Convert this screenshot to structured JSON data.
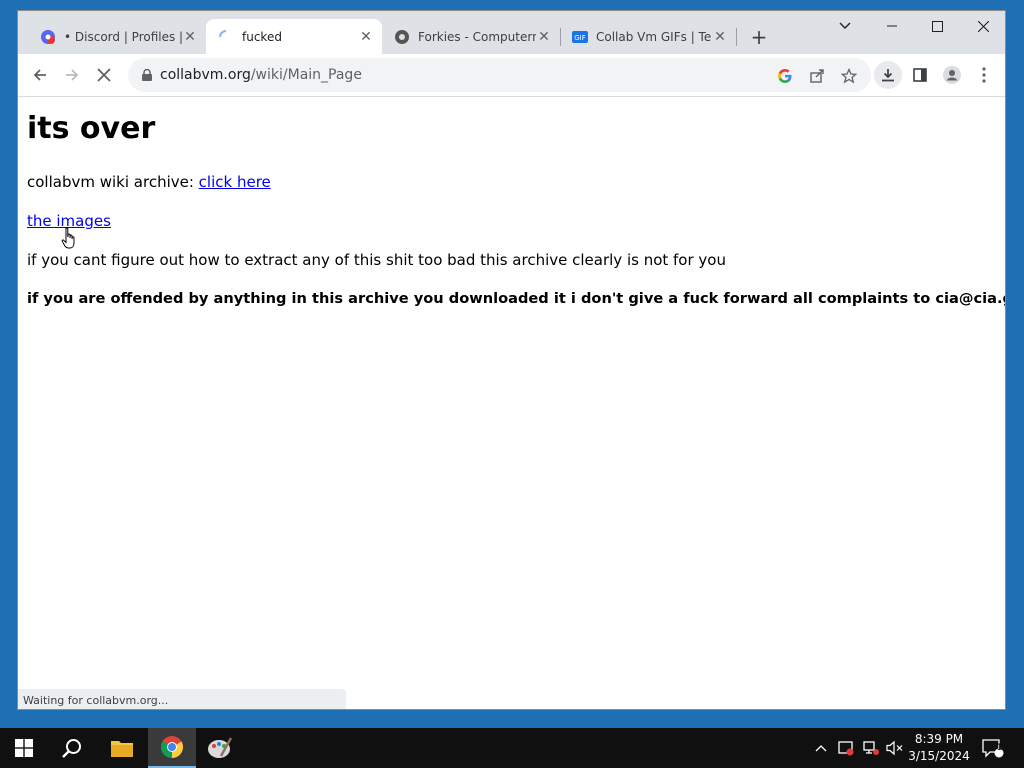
{
  "browser": {
    "tabs": [
      {
        "title": "• Discord | Profiles | U",
        "icon": "discord-favicon"
      },
      {
        "title": "fucked",
        "icon": "loading-spinner-icon"
      },
      {
        "title": "Forkies - Computerne",
        "icon": "forkies-favicon"
      },
      {
        "title": "Collab Vm GIFs | Tenc",
        "icon": "gif-favicon"
      }
    ],
    "url_host": "collabvm.org",
    "url_path": "/wiki/Main_Page",
    "status_text": "Waiting for collabvm.org..."
  },
  "page": {
    "heading": "its over",
    "archive_prefix": "collabvm wiki archive: ",
    "archive_link": "click here",
    "images_link": "the images",
    "notice": "if you cant figure out how to extract any of this shit too bad this archive clearly is not for you",
    "disclaimer": "if you are offended by anything in this archive you downloaded it i don't give a fuck forward all complaints to cia@cia.gov"
  },
  "taskbar": {
    "time": "8:39 PM",
    "date": "3/15/2024",
    "notification_count": "1"
  },
  "colors": {
    "link": "#0000ee",
    "tabstrip": "#dee1e6",
    "taskbar": "#101010"
  }
}
